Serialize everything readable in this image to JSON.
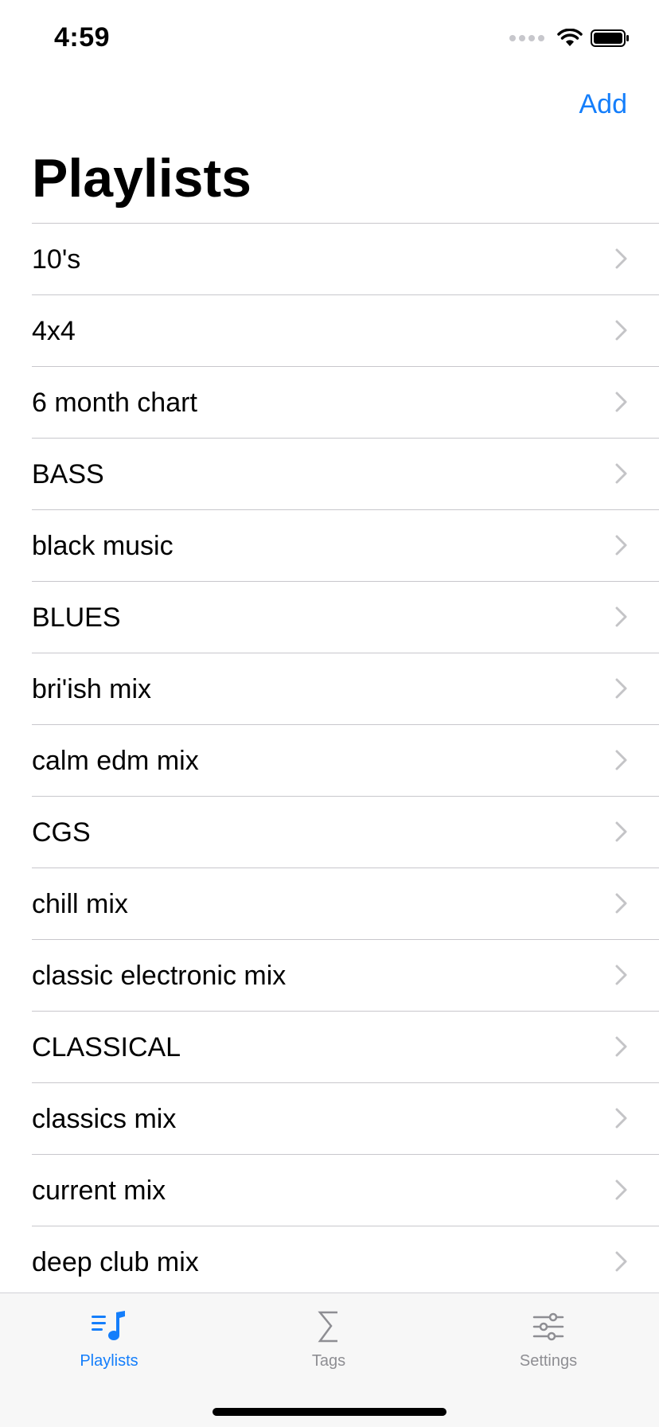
{
  "status": {
    "time": "4:59"
  },
  "nav": {
    "add_label": "Add",
    "title": "Playlists"
  },
  "playlists": [
    {
      "label": "10's"
    },
    {
      "label": "4x4"
    },
    {
      "label": "6 month chart"
    },
    {
      "label": "BASS"
    },
    {
      "label": "black music"
    },
    {
      "label": "BLUES"
    },
    {
      "label": "bri'ish mix"
    },
    {
      "label": "calm edm mix"
    },
    {
      "label": "CGS"
    },
    {
      "label": "chill mix"
    },
    {
      "label": "classic electronic mix"
    },
    {
      "label": "CLASSICAL"
    },
    {
      "label": "classics mix"
    },
    {
      "label": "current mix"
    },
    {
      "label": "deep club mix"
    }
  ],
  "tabbar": {
    "tabs": [
      {
        "label": "Playlists",
        "icon": "playlist-music-icon",
        "active": true
      },
      {
        "label": "Tags",
        "icon": "sigma-icon",
        "active": false
      },
      {
        "label": "Settings",
        "icon": "sliders-icon",
        "active": false
      }
    ]
  },
  "colors": {
    "accent": "#147efb",
    "inactive": "#8e8e93",
    "separator": "#c8c7cc"
  }
}
